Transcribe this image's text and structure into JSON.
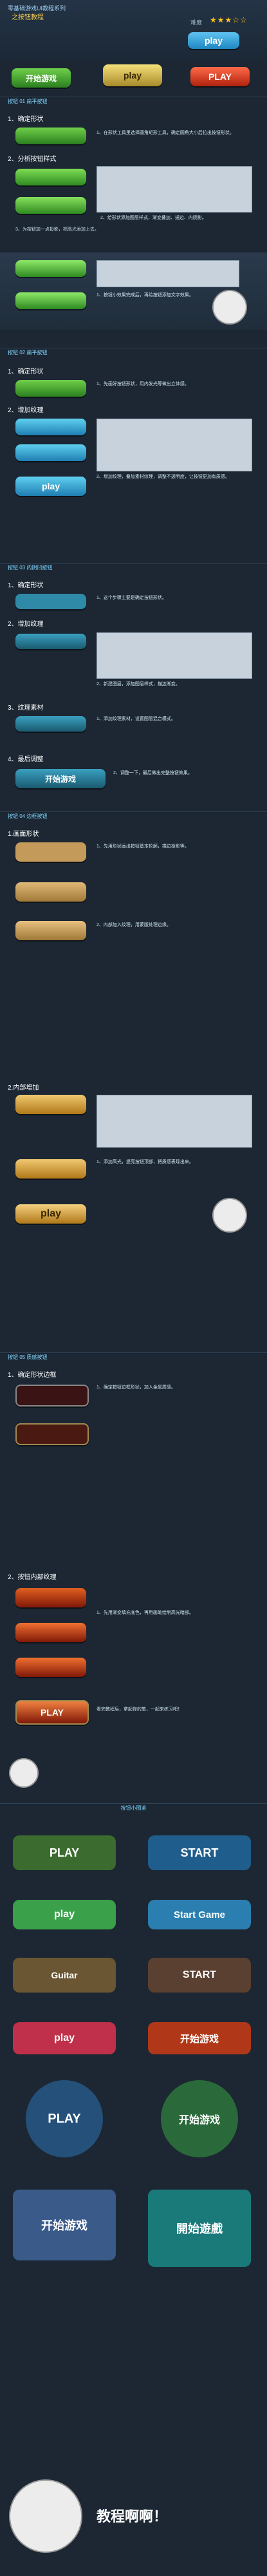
{
  "header": {
    "title": "零基础游戏UI教程系列",
    "subtitle": "之按钮教程",
    "rating_label": "难度",
    "stars": "★★★☆☆"
  },
  "top_buttons": [
    {
      "label": "play",
      "color": "#2b9fd8"
    },
    {
      "label": "开始游戏",
      "color": "#3a9e2c"
    },
    {
      "label": "play",
      "color": "#c9b24a"
    },
    {
      "label": "PLAY",
      "color": "#c9402a"
    }
  ],
  "sections": [
    {
      "title": "按钮 01  扁平按钮",
      "steps": [
        "1、确定形状",
        "2、分析按钮样式",
        "3、",
        "4、"
      ]
    },
    {
      "title": "按钮 02  扁平按钮",
      "steps": [
        "1、确定形状",
        "2、增加纹理"
      ]
    },
    {
      "title": "按钮 03  内阴凹按钮",
      "steps": [
        "1、确定形状",
        "2、增加纹理",
        "3、纹理素材",
        "4、最后调整"
      ]
    },
    {
      "title": "按钮 04  边框按钮",
      "steps": [
        "1.画面形状",
        "2.内部增加"
      ]
    },
    {
      "title": "按钮 05  质感按钮",
      "steps": [
        "1、确定形状边框",
        "2、按钮内部纹理"
      ]
    }
  ],
  "notes": {
    "s1a": "1、在形状工具里选择圆角矩形工具，确定圆角大小后拉出按钮形状。",
    "s1b": "2、给形状添加图层样式，渐变叠加、描边、内阴影。",
    "s1c": "3、为按钮加一点投影，把高光添加上去。",
    "s1d": "1、按钮小效果完成后，再给按钮添加文字效果。",
    "s2a": "1、先画好按钮形状，用内发光等做出立体感。",
    "s2b": "2、增加纹理，叠加素材纹理，调整不透明度，让按钮更加有质感。",
    "s3a": "1、这个步骤主要是确定按钮形状。",
    "s3b": "2、新建图层，添加图层样式，描边渐变。",
    "s3c": "1、添加纹理素材，设置图层混合模式。",
    "s3d": "2、调整一下，最后做出完整按钮效果。",
    "s4a": "1、先用形状画出按钮基本轮廓，描边投影等。",
    "s4b": "2、内部加入纹理，用蒙版处理边缘。",
    "s4c": "1、添加高光，提亮按钮顶部，把质感表现出来。",
    "s5a": "1、确定按钮边框形状，加入金属质感。",
    "s5b": "1、先用渐变填充底色，再用画笔绘制高光暗部。"
  },
  "mid_buttons": [
    {
      "label": "开始游戏"
    },
    {
      "label": "play"
    },
    {
      "label": "PLAY"
    }
  ],
  "final_text": "看完教程后，拿起你的笔，一起来练习吧！",
  "gallery_title": "按钮小图鉴",
  "gallery": [
    {
      "label": "PLAY",
      "color": "#3b6b2e"
    },
    {
      "label": "START",
      "color": "#1f5e8c"
    },
    {
      "label": "play",
      "color": "#3aa04a"
    },
    {
      "label": "Start Game",
      "color": "#2a7fb0"
    },
    {
      "label": "Guitar",
      "color": "#6a5632"
    },
    {
      "label": "START",
      "color": "#5a4030"
    },
    {
      "label": "play",
      "color": "#c0304a"
    },
    {
      "label": "开始游戏",
      "color": "#b03818"
    },
    {
      "label": "PLAY",
      "color": "#24507a"
    },
    {
      "label": "开始游戏",
      "color": "#2a6a3a"
    },
    {
      "label": "开始游戏",
      "color": "#3a5a8a"
    },
    {
      "label": "開始遊戲",
      "color": "#1a7a7a"
    }
  ],
  "bottom_text": "教程啊啊！"
}
